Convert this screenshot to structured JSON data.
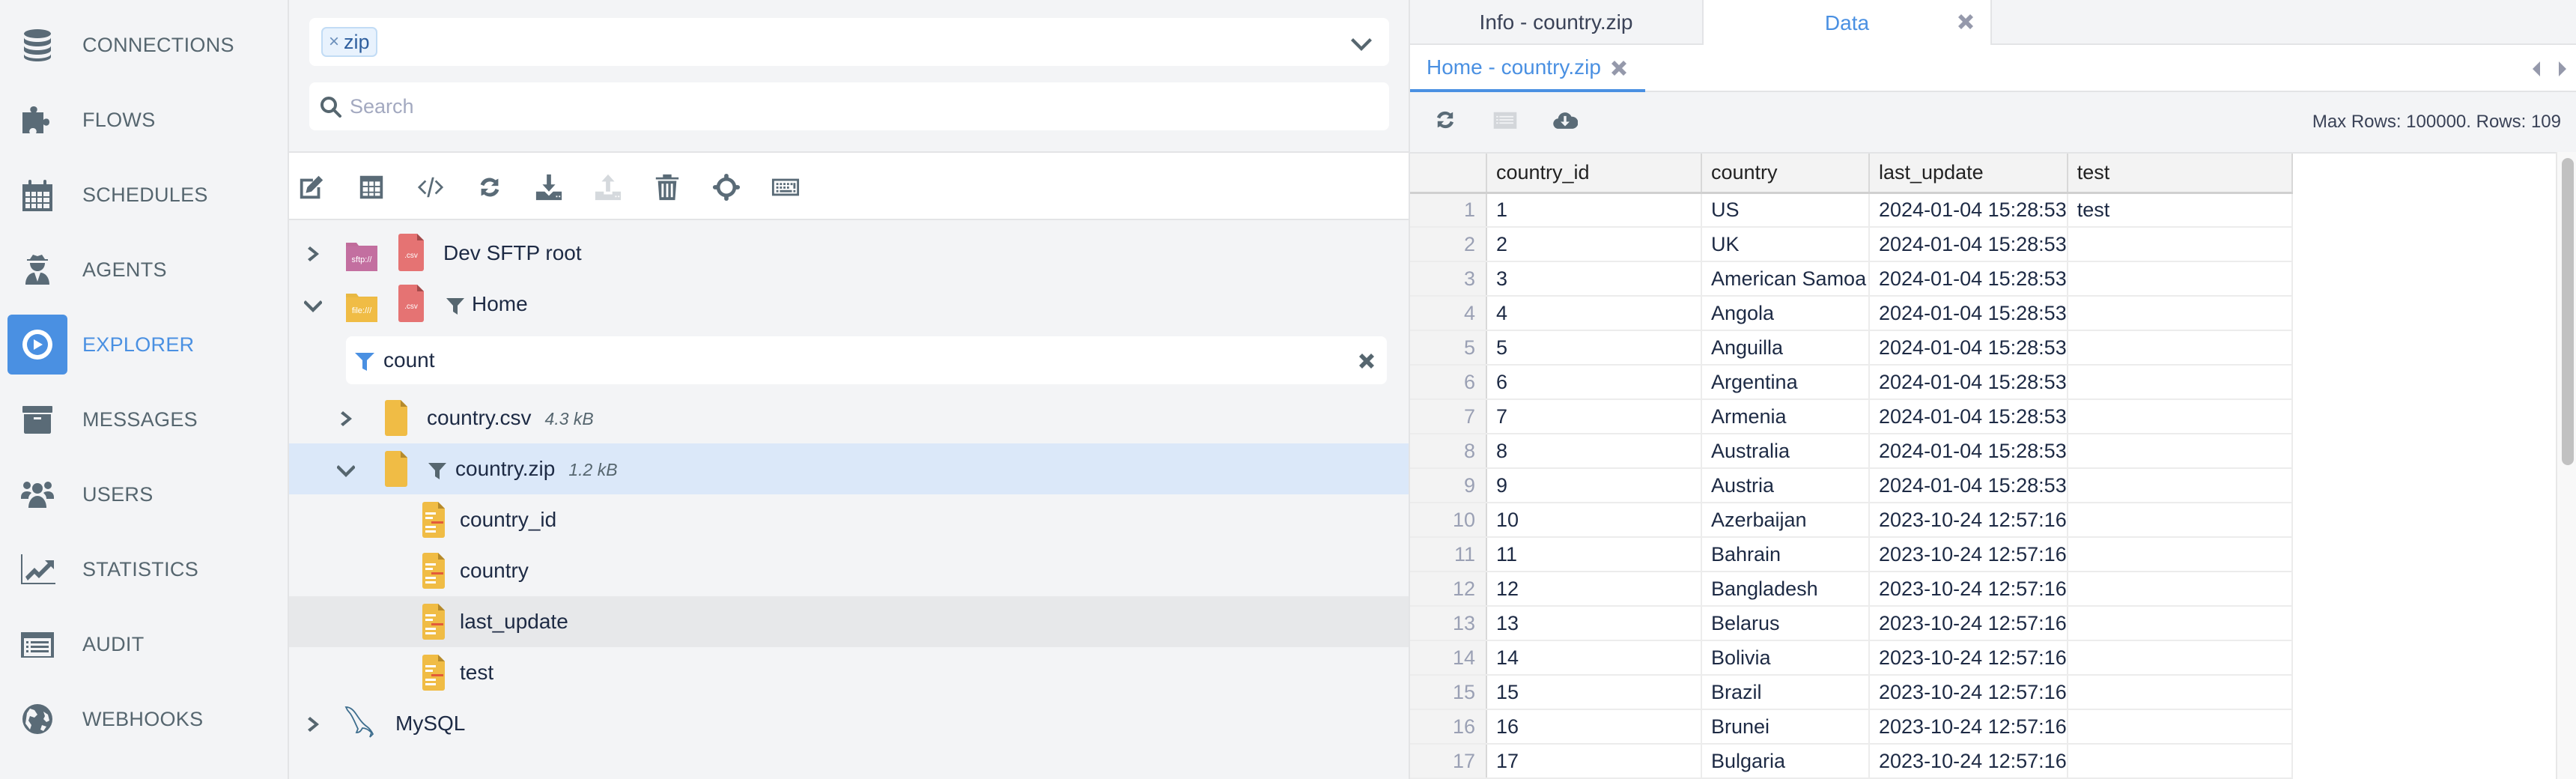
{
  "sidebar": {
    "items": [
      {
        "label": "CONNECTIONS",
        "icon": "database-icon"
      },
      {
        "label": "FLOWS",
        "icon": "puzzle-icon"
      },
      {
        "label": "SCHEDULES",
        "icon": "calendar-icon"
      },
      {
        "label": "AGENTS",
        "icon": "agent-spy-icon"
      },
      {
        "label": "EXPLORER",
        "icon": "compass-icon",
        "active": true
      },
      {
        "label": "MESSAGES",
        "icon": "archive-box-icon"
      },
      {
        "label": "USERS",
        "icon": "users-icon"
      },
      {
        "label": "STATISTICS",
        "icon": "line-chart-icon"
      },
      {
        "label": "AUDIT",
        "icon": "list-icon"
      },
      {
        "label": "WEBHOOKS",
        "icon": "globe-icon"
      }
    ],
    "accent": "#4a90e2"
  },
  "explorer": {
    "tag_filter": {
      "tags": [
        {
          "label": "zip",
          "remove": "×"
        }
      ]
    },
    "search": {
      "placeholder": "Search",
      "value": ""
    },
    "toolbar": [
      "edit-icon",
      "table-icon",
      "code-icon",
      "refresh-icon",
      "download-icon",
      "upload-icon",
      "trash-icon",
      "crosshairs-icon",
      "keyboard-icon"
    ],
    "tree": {
      "dev_sftp": {
        "label": "Dev SFTP root",
        "protocol": "sftp://",
        "file_badge": ".csv"
      },
      "home": {
        "label": "Home",
        "protocol": "file:///",
        "file_badge": ".csv"
      },
      "filter": {
        "value": "count"
      },
      "country_csv": {
        "label": "country.csv",
        "size": "4.3 kB"
      },
      "country_zip": {
        "label": "country.zip",
        "size": "1.2 kB"
      },
      "fields": [
        "country_id",
        "country",
        "last_update",
        "test"
      ],
      "mysql": {
        "label": "MySQL"
      }
    }
  },
  "right": {
    "tabs": [
      {
        "label": "Info - country.zip",
        "active": false
      },
      {
        "label": "Data",
        "active": true
      }
    ],
    "sub_tab": {
      "label": "Home - country.zip"
    },
    "rows_info": "Max Rows: 100000. Rows: 109",
    "table": {
      "columns": [
        "country_id",
        "country",
        "last_update",
        "test"
      ],
      "rows": [
        [
          "1",
          "1",
          "US",
          "2024-01-04 15:28:53",
          "test"
        ],
        [
          "2",
          "2",
          "UK",
          "2024-01-04 15:28:53",
          ""
        ],
        [
          "3",
          "3",
          "American Samoa",
          "2024-01-04 15:28:53",
          ""
        ],
        [
          "4",
          "4",
          "Angola",
          "2024-01-04 15:28:53",
          ""
        ],
        [
          "5",
          "5",
          "Anguilla",
          "2024-01-04 15:28:53",
          ""
        ],
        [
          "6",
          "6",
          "Argentina",
          "2024-01-04 15:28:53",
          ""
        ],
        [
          "7",
          "7",
          "Armenia",
          "2024-01-04 15:28:53",
          ""
        ],
        [
          "8",
          "8",
          "Australia",
          "2024-01-04 15:28:53",
          ""
        ],
        [
          "9",
          "9",
          "Austria",
          "2024-01-04 15:28:53",
          ""
        ],
        [
          "10",
          "10",
          "Azerbaijan",
          "2023-10-24 12:57:16",
          ""
        ],
        [
          "11",
          "11",
          "Bahrain",
          "2023-10-24 12:57:16",
          ""
        ],
        [
          "12",
          "12",
          "Bangladesh",
          "2023-10-24 12:57:16",
          ""
        ],
        [
          "13",
          "13",
          "Belarus",
          "2023-10-24 12:57:16",
          ""
        ],
        [
          "14",
          "14",
          "Bolivia",
          "2023-10-24 12:57:16",
          ""
        ],
        [
          "15",
          "15",
          "Brazil",
          "2023-10-24 12:57:16",
          ""
        ],
        [
          "16",
          "16",
          "Brunei",
          "2023-10-24 12:57:16",
          ""
        ],
        [
          "17",
          "17",
          "Bulgaria",
          "2023-10-24 12:57:16",
          ""
        ]
      ]
    }
  }
}
